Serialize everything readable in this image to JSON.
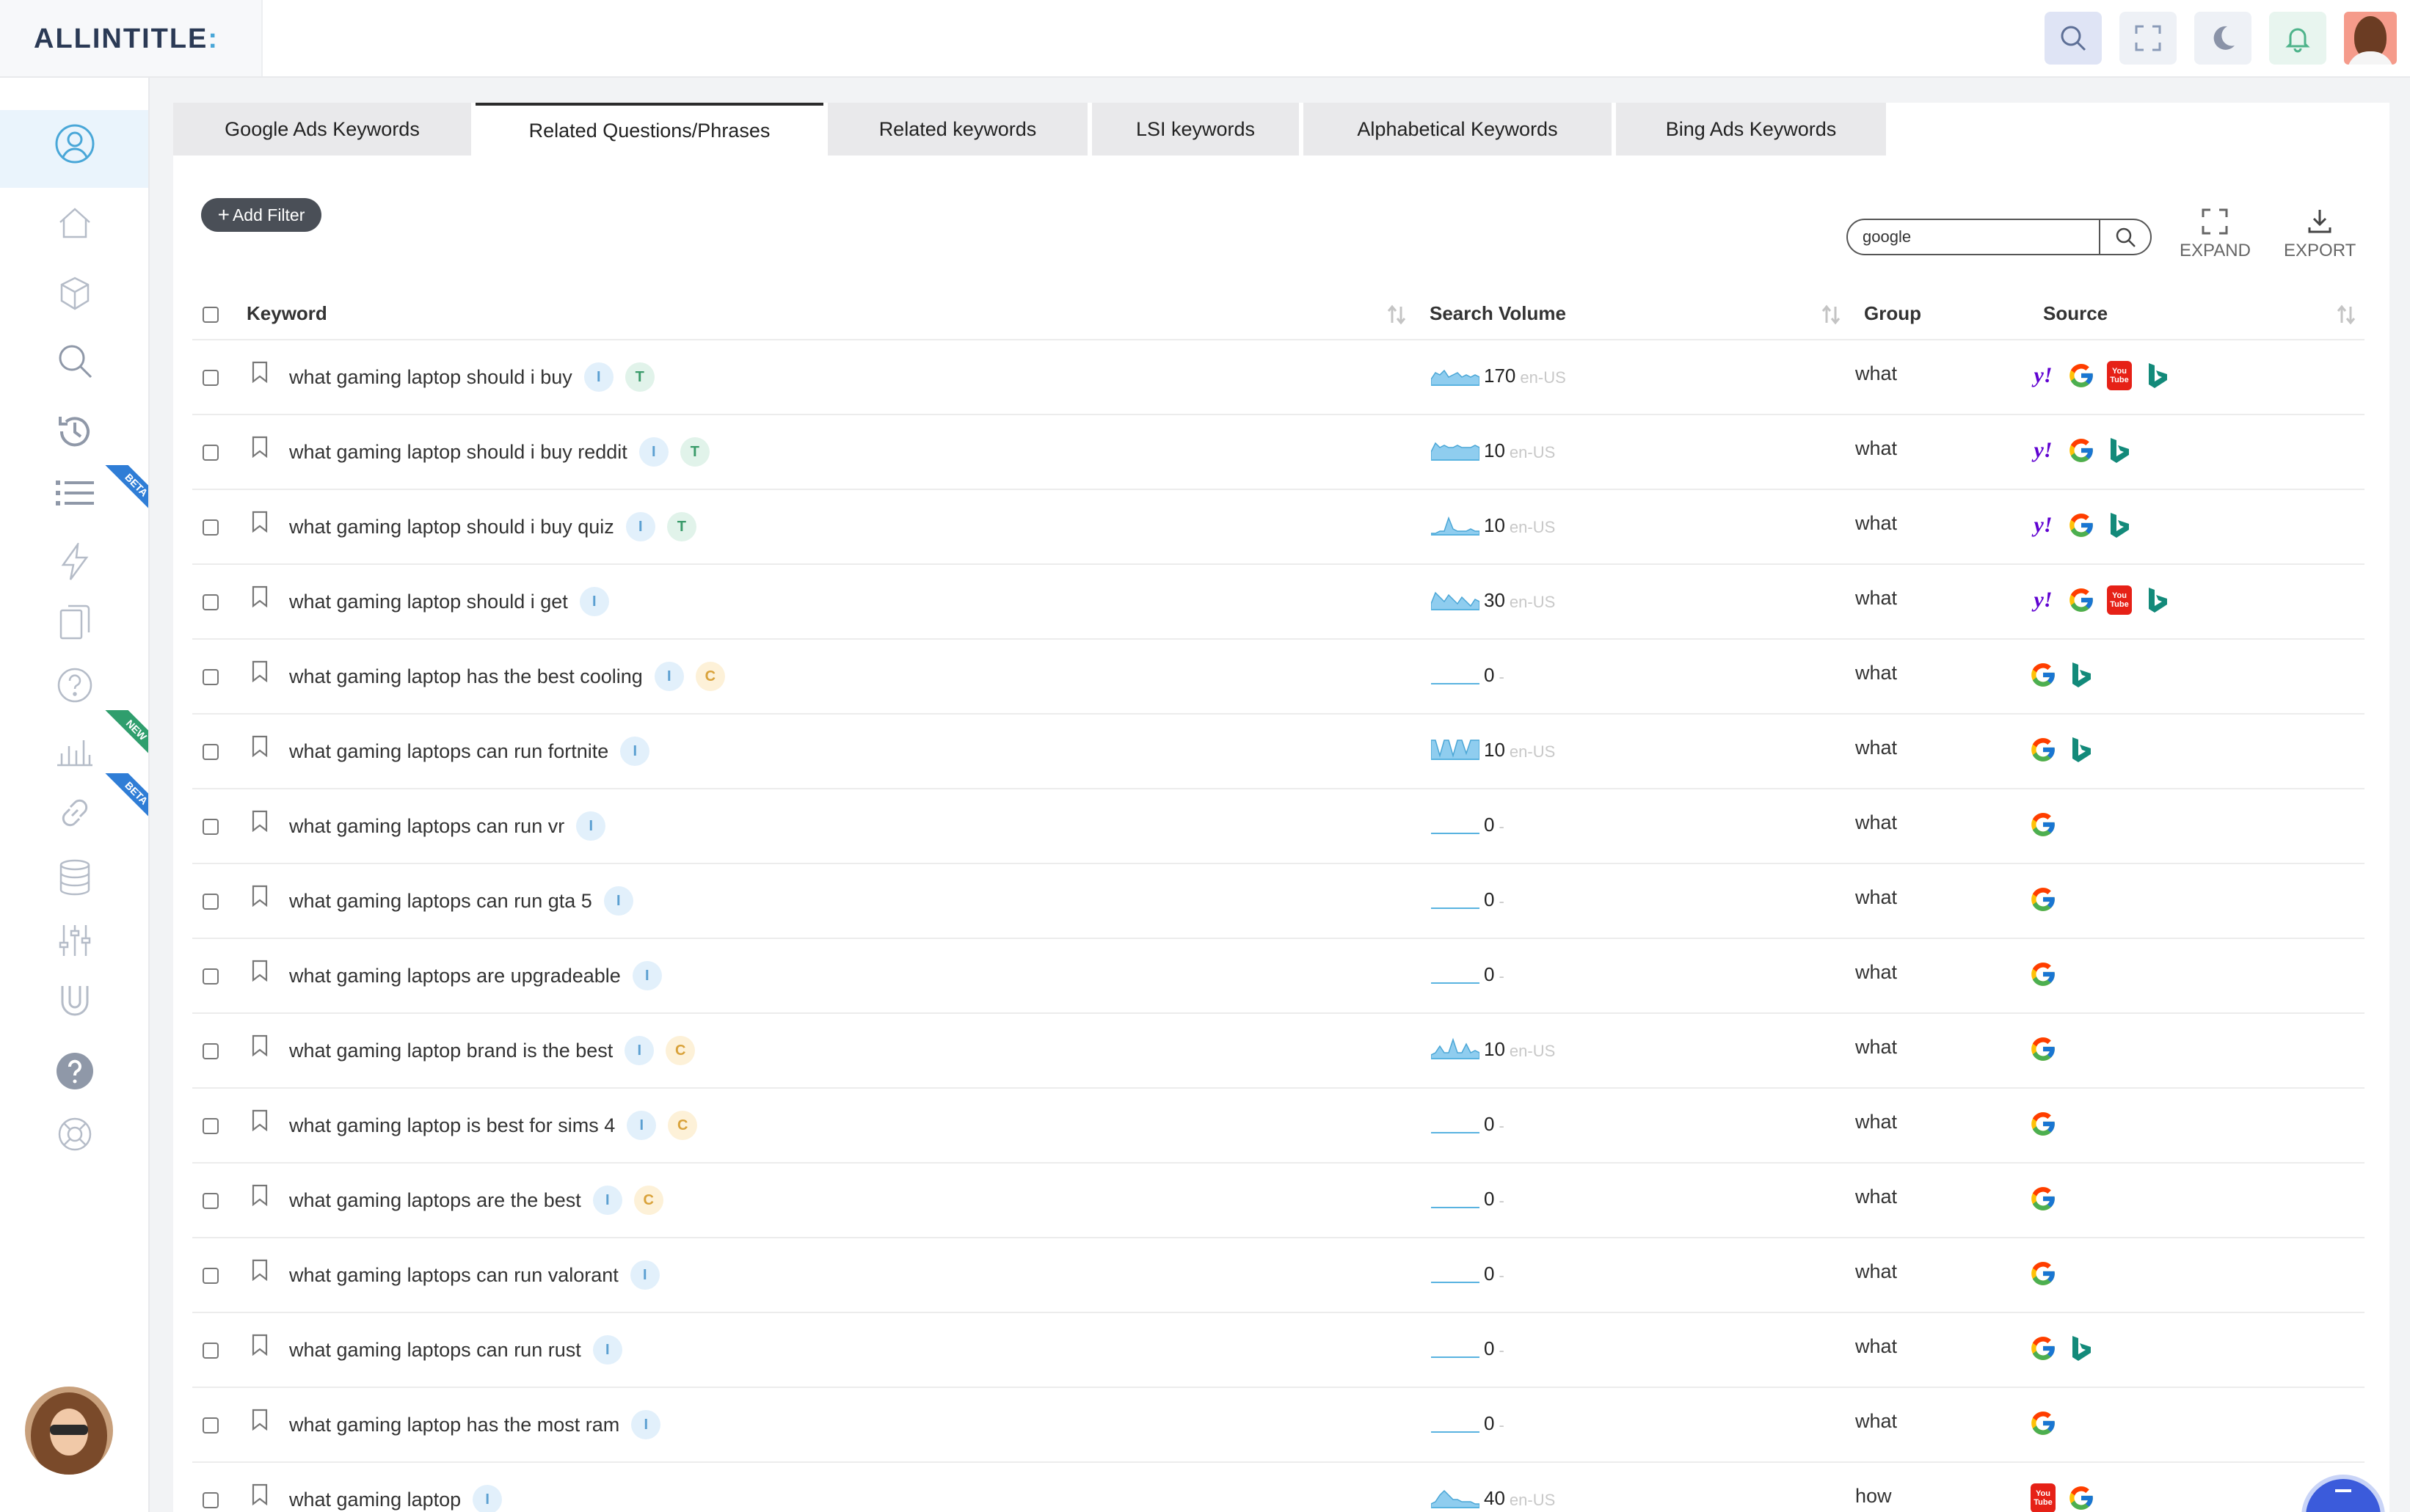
{
  "app": {
    "logo_main": "ALLINTITLE",
    "logo_accent": ":"
  },
  "colors": {
    "accent": "#3b5bdb",
    "sidebar_active": "#eaf4fc",
    "volume_chart": "#59b3e0",
    "filter_button": "#4a4f57"
  },
  "topbar": {
    "icons": [
      "search-icon",
      "fullscreen-icon",
      "moon-icon",
      "bell-icon",
      "user-avatar"
    ]
  },
  "sidebar": {
    "icons": [
      "user-circle-icon",
      "home-icon",
      "cube-icon",
      "search-icon",
      "history-icon",
      "list-icon",
      "lightning-icon",
      "copy-icon",
      "question-icon",
      "bar-chart-icon",
      "link-icon",
      "database-icon",
      "sliders-icon",
      "magnet-icon",
      "help-filled-icon",
      "lifebuoy-icon"
    ],
    "badges": {
      "list": "BETA",
      "chart": "NEW",
      "link": "BETA"
    }
  },
  "tabs": [
    "Google Ads Keywords",
    "Related Questions/Phrases",
    "Related keywords",
    "LSI keywords",
    "Alphabetical Keywords",
    "Bing Ads Keywords"
  ],
  "active_tab": "Related Questions/Phrases",
  "toolbar": {
    "add_filter": "Add Filter",
    "search_value": "google",
    "expand": "EXPAND",
    "export": "EXPORT"
  },
  "table": {
    "columns": {
      "keyword": "Keyword",
      "volume": "Search Volume",
      "group": "Group",
      "source": "Source"
    },
    "rows": [
      {
        "keyword": "what gaming laptop should i buy",
        "badges": [
          "I",
          "T"
        ],
        "volume": "170",
        "locale": "en-US",
        "trend": [
          0.3,
          0.6,
          0.5,
          0.7,
          0.4,
          0.5,
          0.6,
          0.4,
          0.5,
          0.4,
          0.5,
          0.4
        ],
        "group": "what",
        "sources": [
          "yahoo",
          "google",
          "youtube",
          "bing"
        ]
      },
      {
        "keyword": "what gaming laptop should i buy reddit",
        "badges": [
          "I",
          "T"
        ],
        "volume": "10",
        "locale": "en-US",
        "trend": [
          0.4,
          0.8,
          0.6,
          0.7,
          0.6,
          0.6,
          0.7,
          0.6,
          0.6,
          0.6,
          0.7,
          0.6
        ],
        "group": "what",
        "sources": [
          "yahoo",
          "google",
          "bing"
        ]
      },
      {
        "keyword": "what gaming laptop should i buy quiz",
        "badges": [
          "I",
          "T"
        ],
        "volume": "10",
        "locale": "en-US",
        "trend": [
          0.1,
          0.1,
          0.2,
          0.2,
          0.8,
          0.3,
          0.2,
          0.2,
          0.2,
          0.3,
          0.2,
          0.2
        ],
        "group": "what",
        "sources": [
          "yahoo",
          "google",
          "bing"
        ]
      },
      {
        "keyword": "what gaming laptop should i get",
        "badges": [
          "I"
        ],
        "volume": "30",
        "locale": "en-US",
        "trend": [
          0.3,
          0.8,
          0.6,
          0.4,
          0.7,
          0.5,
          0.3,
          0.6,
          0.4,
          0.2,
          0.5,
          0.4
        ],
        "group": "what",
        "sources": [
          "yahoo",
          "google",
          "youtube",
          "bing"
        ]
      },
      {
        "keyword": "what gaming laptop has the best cooling",
        "badges": [
          "I",
          "C"
        ],
        "volume": "0",
        "locale": "-",
        "trend": [],
        "group": "what",
        "sources": [
          "google",
          "bing"
        ]
      },
      {
        "keyword": "what gaming laptops can run fortnite",
        "badges": [
          "I"
        ],
        "volume": "10",
        "locale": "en-US",
        "trend": [
          0.9,
          0.9,
          0.2,
          0.9,
          0.9,
          0.2,
          0.9,
          0.9,
          0.3,
          0.9,
          0.9,
          0.9
        ],
        "group": "what",
        "sources": [
          "google",
          "bing"
        ]
      },
      {
        "keyword": "what gaming laptops can run vr",
        "badges": [
          "I"
        ],
        "volume": "0",
        "locale": "-",
        "trend": [],
        "group": "what",
        "sources": [
          "google"
        ]
      },
      {
        "keyword": "what gaming laptops can run gta 5",
        "badges": [
          "I"
        ],
        "volume": "0",
        "locale": "-",
        "trend": [],
        "group": "what",
        "sources": [
          "google"
        ]
      },
      {
        "keyword": "what gaming laptops are upgradeable",
        "badges": [
          "I"
        ],
        "volume": "0",
        "locale": "-",
        "trend": [],
        "group": "what",
        "sources": [
          "google"
        ]
      },
      {
        "keyword": "what gaming laptop brand is the best",
        "badges": [
          "I",
          "C"
        ],
        "volume": "10",
        "locale": "en-US",
        "trend": [
          0.2,
          0.3,
          0.6,
          0.3,
          0.3,
          0.9,
          0.3,
          0.3,
          0.7,
          0.3,
          0.4,
          0.3
        ],
        "group": "what",
        "sources": [
          "google"
        ]
      },
      {
        "keyword": "what gaming laptop is best for sims 4",
        "badges": [
          "I",
          "C"
        ],
        "volume": "0",
        "locale": "-",
        "trend": [],
        "group": "what",
        "sources": [
          "google"
        ]
      },
      {
        "keyword": "what gaming laptops are the best",
        "badges": [
          "I",
          "C"
        ],
        "volume": "0",
        "locale": "-",
        "trend": [],
        "group": "what",
        "sources": [
          "google"
        ]
      },
      {
        "keyword": "what gaming laptops can run valorant",
        "badges": [
          "I"
        ],
        "volume": "0",
        "locale": "-",
        "trend": [],
        "group": "what",
        "sources": [
          "google"
        ]
      },
      {
        "keyword": "what gaming laptops can run rust",
        "badges": [
          "I"
        ],
        "volume": "0",
        "locale": "-",
        "trend": [],
        "group": "what",
        "sources": [
          "google",
          "bing"
        ]
      },
      {
        "keyword": "what gaming laptop has the most ram",
        "badges": [
          "I"
        ],
        "volume": "0",
        "locale": "-",
        "trend": [],
        "group": "what",
        "sources": [
          "google"
        ]
      },
      {
        "keyword": "what gaming laptop",
        "badges": [
          "I"
        ],
        "volume": "40",
        "locale": "en-US",
        "trend": [
          0.2,
          0.3,
          0.6,
          0.8,
          0.6,
          0.4,
          0.4,
          0.3,
          0.3,
          0.3,
          0.2,
          0.2
        ],
        "group": "how",
        "sources": [
          "youtube",
          "google"
        ]
      }
    ]
  }
}
